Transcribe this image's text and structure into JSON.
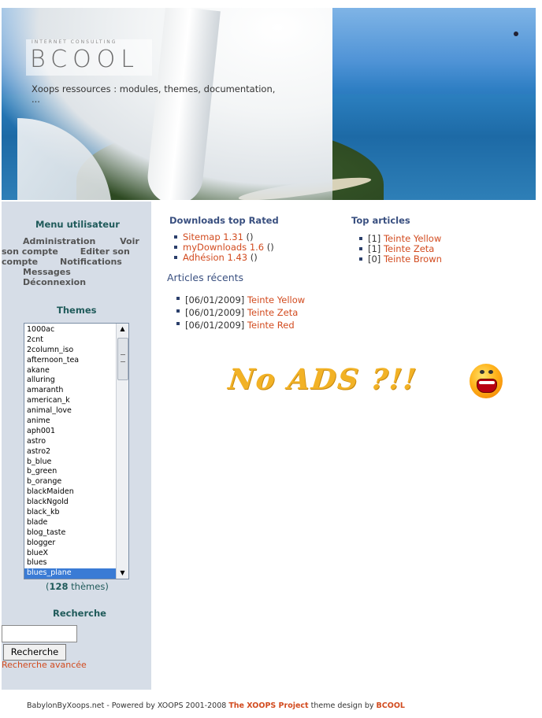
{
  "header": {
    "logo_top": "INTERNET CONSULTING",
    "logo": "BCOOL",
    "tagline": "Xoops ressources : modules, themes, documentation, ..."
  },
  "sidebar": {
    "user_menu_title": "Menu utilisateur",
    "user_menu_items": [
      "Administration",
      "Voir son compte",
      "Editer son compte",
      "Notifications",
      "Messages",
      "Déconnexion"
    ],
    "themes_title": "Themes",
    "themes": [
      "1000ac",
      "2cnt",
      "2column_iso",
      "afternoon_tea",
      "akane",
      "alluring",
      "amaranth",
      "american_k",
      "animal_love",
      "anime",
      "aph001",
      "astro",
      "astro2",
      "b_blue",
      "b_green",
      "b_orange",
      "blackMaiden",
      "blackNgold",
      "black_kb",
      "blade",
      "blog_taste",
      "blogger",
      "blueX",
      "blues",
      "blues_plane"
    ],
    "selected_theme": "blues_plane",
    "theme_count_open": "(",
    "theme_count": "128",
    "theme_count_suffix": " thèmes)",
    "search_title": "Recherche",
    "search_value": "",
    "search_button": "Recherche",
    "advanced_search": "Recherche avancée"
  },
  "downloads": {
    "title": "Downloads top Rated",
    "items": [
      {
        "label": "Sitemap 1.31",
        "suffix": " ()"
      },
      {
        "label": "myDownloads 1.6",
        "suffix": " ()"
      },
      {
        "label": "Adhésion 1.43",
        "suffix": " ()"
      }
    ]
  },
  "top_articles": {
    "title": "Top articles",
    "items": [
      {
        "prefix": "[1] ",
        "label": "Teinte Yellow"
      },
      {
        "prefix": "[1] ",
        "label": "Teinte Zeta"
      },
      {
        "prefix": "[0] ",
        "label": "Teinte Brown"
      }
    ]
  },
  "recent_articles": {
    "title": "Articles récents",
    "items": [
      {
        "prefix": "[06/01/2009] ",
        "label": "Teinte Yellow"
      },
      {
        "prefix": "[06/01/2009] ",
        "label": "Teinte Zeta"
      },
      {
        "prefix": "[06/01/2009] ",
        "label": "Teinte Red"
      }
    ]
  },
  "ad_banner": {
    "text": "No ADS ?!!"
  },
  "footer": {
    "part1": "BabylonByXoops.net - Powered by XOOPS 2001-2008 ",
    "link1": "The XOOPS Project",
    "part2": " theme design by ",
    "link2": "BCOOL"
  },
  "colors": {
    "link": "#d24b1f",
    "sidebar_bg": "#d6dde7",
    "title": "#3a5080",
    "selection": "#3a7bd5"
  }
}
